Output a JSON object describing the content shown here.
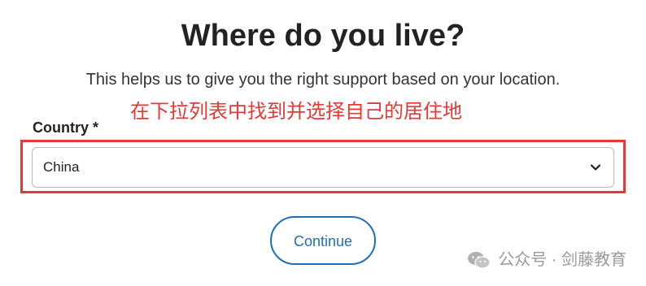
{
  "header": {
    "title": "Where do you live?",
    "subtitle": "This helps us to give you the right support based on your location."
  },
  "annotation": {
    "text": "在下拉列表中找到并选择自己的居住地",
    "color": "#e53935"
  },
  "form": {
    "country_label": "Country *",
    "country_value": "China",
    "country_icon": "chevron-down-icon"
  },
  "actions": {
    "continue_label": "Continue",
    "accent_color": "#1f6fb5"
  },
  "watermark": {
    "icon": "wechat-icon",
    "text": "公众号 · 剑藤教育"
  }
}
